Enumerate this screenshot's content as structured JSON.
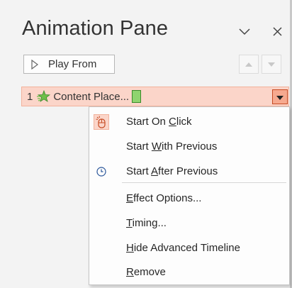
{
  "pane": {
    "title": "Animation Pane",
    "collapse_icon": "chevron-down-icon",
    "close_icon": "close-icon"
  },
  "toolbar": {
    "play_from_label": "Play From",
    "play_icon": "play-icon",
    "move_up_icon": "triangle-up-icon",
    "move_down_icon": "triangle-down-icon"
  },
  "animation_list": [
    {
      "index": "1",
      "effect_icon": "entrance-effect-star-icon",
      "name": "Content Place...",
      "selected": true
    }
  ],
  "context_menu": {
    "timing_items": [
      {
        "pre": "Start On ",
        "u": "C",
        "post": "lick",
        "icon": "mouse-click-icon",
        "checked": true
      },
      {
        "pre": "Start ",
        "u": "W",
        "post": "ith Previous",
        "icon": "",
        "checked": false
      },
      {
        "pre": "Start ",
        "u": "A",
        "post": "fter Previous",
        "icon": "clock-icon",
        "checked": false
      }
    ],
    "action_items": [
      {
        "pre": "",
        "u": "E",
        "post": "ffect Options..."
      },
      {
        "pre": "",
        "u": "T",
        "post": "iming..."
      },
      {
        "pre": "",
        "u": "H",
        "post": "ide Advanced Timeline"
      },
      {
        "pre": "",
        "u": "R",
        "post": "emove"
      }
    ]
  },
  "colors": {
    "selection_fill": "#fbd5c9",
    "selection_border": "#f2b29c",
    "dropdown_fill": "#f6a98f",
    "timing_bar": "#8fd46f"
  }
}
